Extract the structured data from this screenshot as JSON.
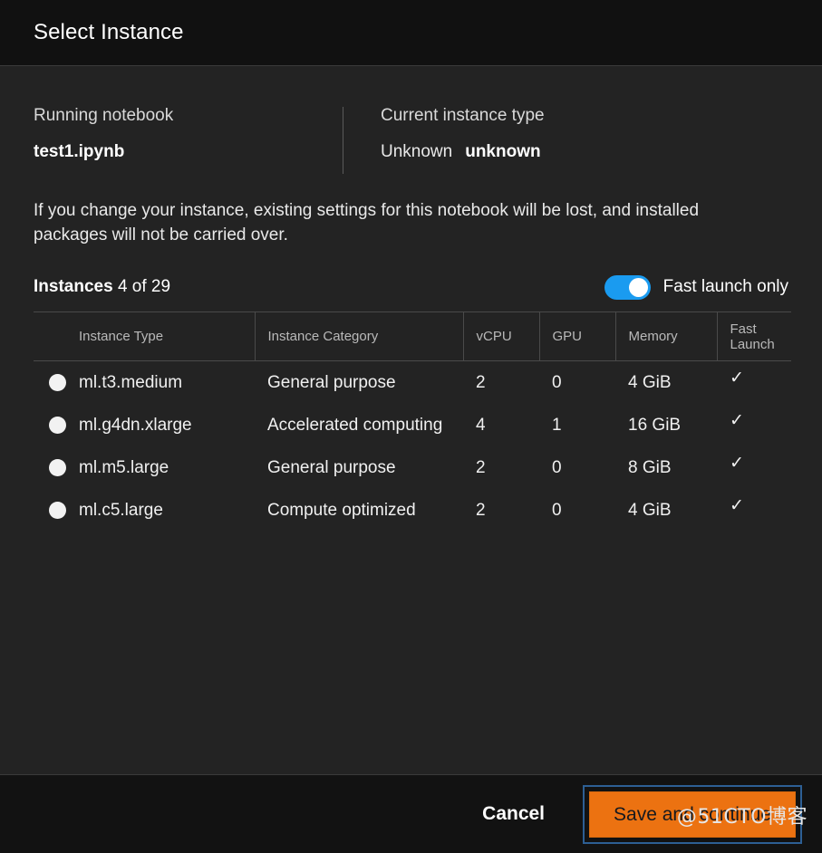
{
  "dialog": {
    "title": "Select Instance"
  },
  "summary": {
    "notebook_label": "Running notebook",
    "notebook_value": "test1.ipynb",
    "instance_type_label": "Current instance type",
    "instance_type_status": "Unknown",
    "instance_type_value": "unknown"
  },
  "notice": "If you change your instance, existing settings for this notebook will be lost, and installed packages will not be carried over.",
  "instances": {
    "heading": "Instances",
    "count_text": "4 of 29",
    "toggle_label": "Fast launch only",
    "toggle_on": true,
    "toggle_color": "#1a9bf0"
  },
  "table": {
    "columns": [
      "Instance Type",
      "Instance Category",
      "vCPU",
      "GPU",
      "Memory",
      "Fast Launch"
    ],
    "rows": [
      {
        "type": "ml.t3.medium",
        "category": "General purpose",
        "vcpu": "2",
        "gpu": "0",
        "memory": "4 GiB",
        "fast_launch": "✓",
        "selected": false
      },
      {
        "type": "ml.g4dn.xlarge",
        "category": "Accelerated computing",
        "vcpu": "4",
        "gpu": "1",
        "memory": "16 GiB",
        "fast_launch": "✓",
        "selected": false
      },
      {
        "type": "ml.m5.large",
        "category": "General purpose",
        "vcpu": "2",
        "gpu": "0",
        "memory": "8 GiB",
        "fast_launch": "✓",
        "selected": false
      },
      {
        "type": "ml.c5.large",
        "category": "Compute optimized",
        "vcpu": "2",
        "gpu": "0",
        "memory": "4 GiB",
        "fast_launch": "✓",
        "selected": false
      }
    ]
  },
  "footer": {
    "cancel_label": "Cancel",
    "save_label": "Save and continue",
    "save_color": "#ec7211",
    "focus_ring_color": "#2d5f94"
  },
  "watermark": "@51CTO博客"
}
